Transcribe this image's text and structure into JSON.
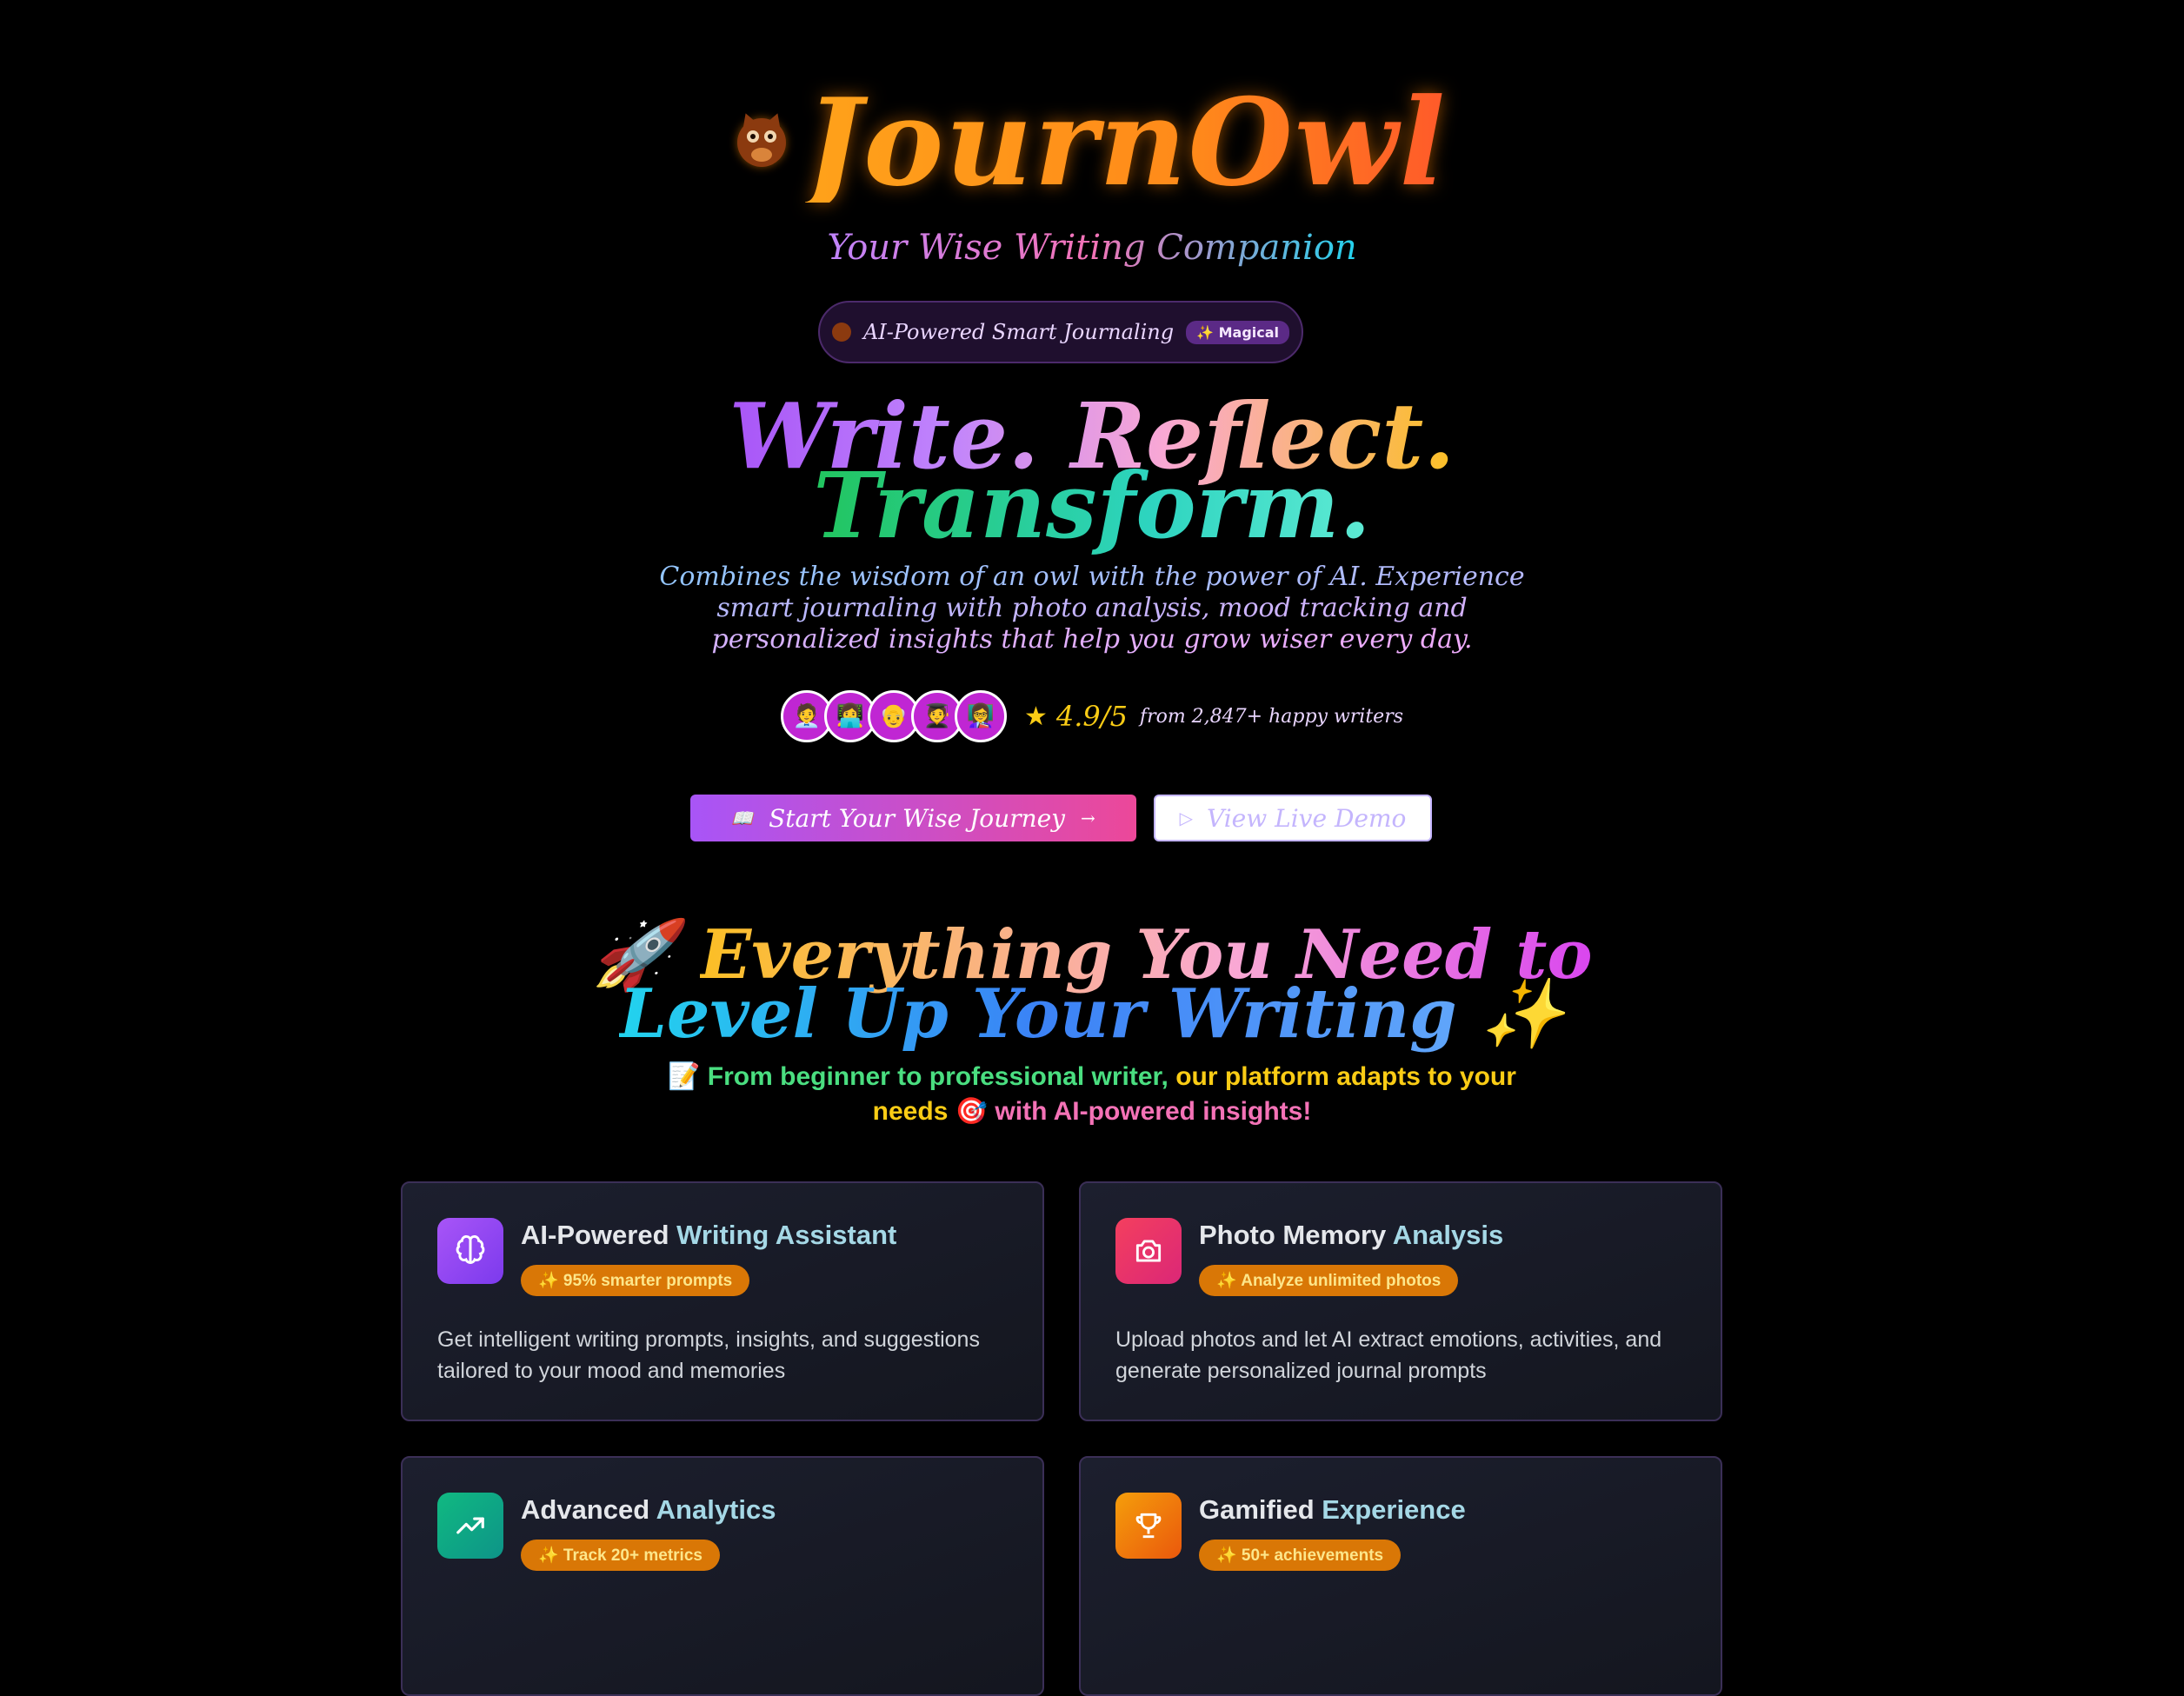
{
  "brand": {
    "name": "JournOwl",
    "tagline": "Your Wise Writing Companion"
  },
  "pill": {
    "text": "AI-Powered Smart Journaling",
    "badge": "✨ Magical"
  },
  "hero": {
    "line1": "Write. Reflect.",
    "line2": "Transform.",
    "description": "Combines the wisdom of an owl with the power of AI. Experience smart journaling with photo analysis, mood tracking and personalized insights that help you grow wiser every day."
  },
  "social_proof": {
    "avatars": [
      "🧑‍💼",
      "👩‍💻",
      "👴",
      "🧑‍🎓",
      "👩‍🏫"
    ],
    "rating": "4.9/5",
    "writers": "from 2,847+ happy writers"
  },
  "cta": {
    "primary": "Start Your Wise Journey",
    "secondary": "View Live Demo"
  },
  "features_section": {
    "title_line1": "Everything You Need to",
    "title_line2": "Level Up Your Writing",
    "subtitle_part1": "📝 From beginner to professional writer,",
    "subtitle_part2": "our platform adapts to your",
    "subtitle_part3": "needs",
    "subtitle_part4": "🎯 with AI-powered insights!"
  },
  "features": [
    {
      "title_main": "AI-Powered",
      "title_accent": "Writing Assistant",
      "badge": "✨ 95% smarter prompts",
      "description": "Get intelligent writing prompts, insights, and suggestions tailored to your mood and memories",
      "icon": "brain-icon",
      "color": "#9333ea"
    },
    {
      "title_main": "Photo Memory",
      "title_accent": "Analysis",
      "badge": "✨ Analyze unlimited photos",
      "description": "Upload photos and let AI extract emotions, activities, and generate personalized journal prompts",
      "icon": "camera-icon",
      "color": "#e11d48"
    },
    {
      "title_main": "Advanced",
      "title_accent": "Analytics",
      "badge": "✨ Track 20+ metrics",
      "description": "",
      "icon": "trending-up-icon",
      "color": "#059669"
    },
    {
      "title_main": "Gamified",
      "title_accent": "Experience",
      "badge": "✨ 50+ achievements",
      "description": "",
      "icon": "trophy-icon",
      "color": "#ea580c"
    }
  ]
}
